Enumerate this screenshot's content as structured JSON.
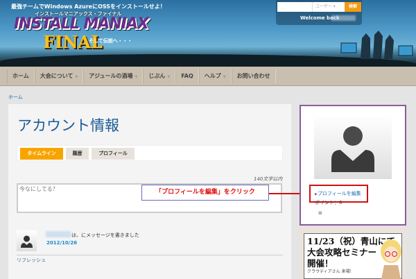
{
  "header": {
    "tagline": "最強チームでWindows AzureにOSSをインストールせよ！",
    "logo_sub": "インストールマニアックス・ファイナル",
    "logo_main": "INSTALL MANIAX",
    "logo_final": "FINAL",
    "logo_tail": "そして伝説へ・・・",
    "search_placeholder": "",
    "search_scope": "ユーザー",
    "search_button": "検索",
    "welcome": "Welcome back"
  },
  "nav": {
    "items": [
      {
        "label": "ホーム",
        "caret": false
      },
      {
        "label": "大会について",
        "caret": true
      },
      {
        "label": "アジュールの酒場",
        "caret": true
      },
      {
        "label": "じぶん",
        "caret": true
      },
      {
        "label": "FAQ",
        "caret": false
      },
      {
        "label": "ヘルプ",
        "caret": true
      },
      {
        "label": "お問い合わせ",
        "caret": false
      }
    ]
  },
  "breadcrumb": "ホーム",
  "main": {
    "title": "アカウント情報",
    "tabs": [
      "タイムライン",
      "履歴",
      "プロフィール"
    ],
    "char_limit": "140文字以内",
    "placeholder": "今なにしてる？",
    "callout": "「プロフィールを編集」をクリック",
    "message": {
      "text": "は、にメッセージを書きました",
      "date": "2012/10/26"
    },
    "refresh": "リフレッシュ"
  },
  "sidebar": {
    "edit_profile": "プロフィールを編集",
    "points": "ポイント：0",
    "bars": "IIIIII",
    "ad_line1": "11/23（祝）青山にて",
    "ad_line2": "大会攻略セミナー",
    "ad_line3": "開催！",
    "ad_small": "クラウディアさん 来場!"
  },
  "colors": {
    "accent": "#f39a10",
    "link": "#1a6ab0",
    "annotation": "#d01010",
    "sidebar_border": "#8a5a9a"
  }
}
